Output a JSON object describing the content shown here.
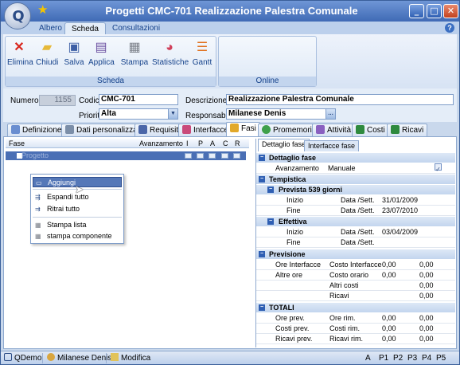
{
  "window": {
    "title": "Progetti CMC-701 Realizzazione Palestra Comunale",
    "minimize": "_",
    "maximize": "□",
    "close": "✕"
  },
  "ribbon_tabs": [
    "Albero",
    "Scheda",
    "Consultazioni"
  ],
  "active_ribbon_tab": "Scheda",
  "ribbon": {
    "group_scheda": {
      "label": "Scheda",
      "buttons": [
        {
          "label": "Elimina",
          "icon": "delete-icon"
        },
        {
          "label": "Chiudi",
          "icon": "close-folder-icon"
        },
        {
          "label": "Salva",
          "icon": "save-icon"
        },
        {
          "label": "Applica",
          "icon": "apply-icon"
        },
        {
          "label": "Stampa",
          "icon": "print-icon"
        },
        {
          "label": "Statistiche",
          "icon": "pie-chart-icon"
        },
        {
          "label": "Gantt",
          "icon": "gantt-icon"
        }
      ]
    },
    "group_online": {
      "label": "Online"
    }
  },
  "form": {
    "numero_label": "Numero",
    "numero_value": "1155",
    "codice_label": "Codice",
    "codice_value": "CMC-701",
    "descrizione_label": "Descrizione",
    "descrizione_value": "Realizzazione Palestra Comunale",
    "priorita_label": "Priorita",
    "priorita_value": "Alta",
    "responsabile_label": "Responsabile",
    "responsabile_value": "Milanese Denis"
  },
  "tabs": [
    "Definizione",
    "Dati personalizzati",
    "Requisiti",
    "Interfacce",
    "Fasi",
    "Promemoria",
    "Attività",
    "Costi",
    "Ricavi"
  ],
  "active_tab": "Fasi",
  "phase_grid": {
    "columns": [
      "Fase",
      "Avanzamento",
      "I",
      "P",
      "A",
      "C",
      "R"
    ],
    "row": {
      "label": "Progetto"
    }
  },
  "context_menu": [
    "Aggiungi",
    "Espandi tutto",
    "Ritrai tutto",
    "Stampa lista",
    "stampa componente"
  ],
  "right_tabs": [
    "Dettaglio fase",
    "Interfacce fase"
  ],
  "detail": {
    "dettaglio": {
      "title": "Dettaglio fase",
      "avanzamento_label": "Avanzamento",
      "avanzamento_value": "Manuale",
      "checked": "✓"
    },
    "tempistica": {
      "title": "Tempistica"
    },
    "prevista": {
      "title": "Prevista 539 giorni",
      "inizio": "Inizio",
      "fine": "Fine",
      "data_sett": "Data /Sett.",
      "inizio_date": "31/01/2009",
      "fine_date": "23/07/2010"
    },
    "effettiva": {
      "title": "Effettiva",
      "inizio": "Inizio",
      "fine": "Fine",
      "data_sett": "Data /Sett.",
      "inizio_date": "03/04/2009",
      "fine_date": ""
    },
    "previsione": {
      "title": "Previsione",
      "ore_interfacce": "Ore Interfacce",
      "costo_interfacce": "Costo Interfacce",
      "v1": "0,00",
      "v2": "0,00",
      "altre_ore": "Altre ore",
      "costo_orario": "Costo orario",
      "v3": "0,00",
      "v4": "0,00",
      "altri_costi": "Altri costi",
      "v5": "0,00",
      "ricavi": "Ricavi",
      "v6": "0,00"
    },
    "totali": {
      "title": "TOTALI",
      "ore_prev": "Ore prev.",
      "ore_rim": "Ore rim.",
      "a1": "0,00",
      "a2": "0,00",
      "costi_prev": "Costi prev.",
      "costi_rim": "Costi rim.",
      "b1": "0,00",
      "b2": "0,00",
      "ricavi_prev": "Ricavi prev.",
      "ricavi_rim": "Ricavi rim.",
      "c1": "0,00",
      "c2": "0,00"
    }
  },
  "statusbar": {
    "app": "QDemo",
    "user": "Milanese Denis",
    "mode": "Modifica",
    "flags": [
      "A",
      "P1",
      "P2",
      "P3",
      "P4",
      "P5"
    ]
  },
  "colors": {
    "title_bar": "#3f6ab5",
    "selection": "#5578b8",
    "section": "#c3d5ee"
  }
}
